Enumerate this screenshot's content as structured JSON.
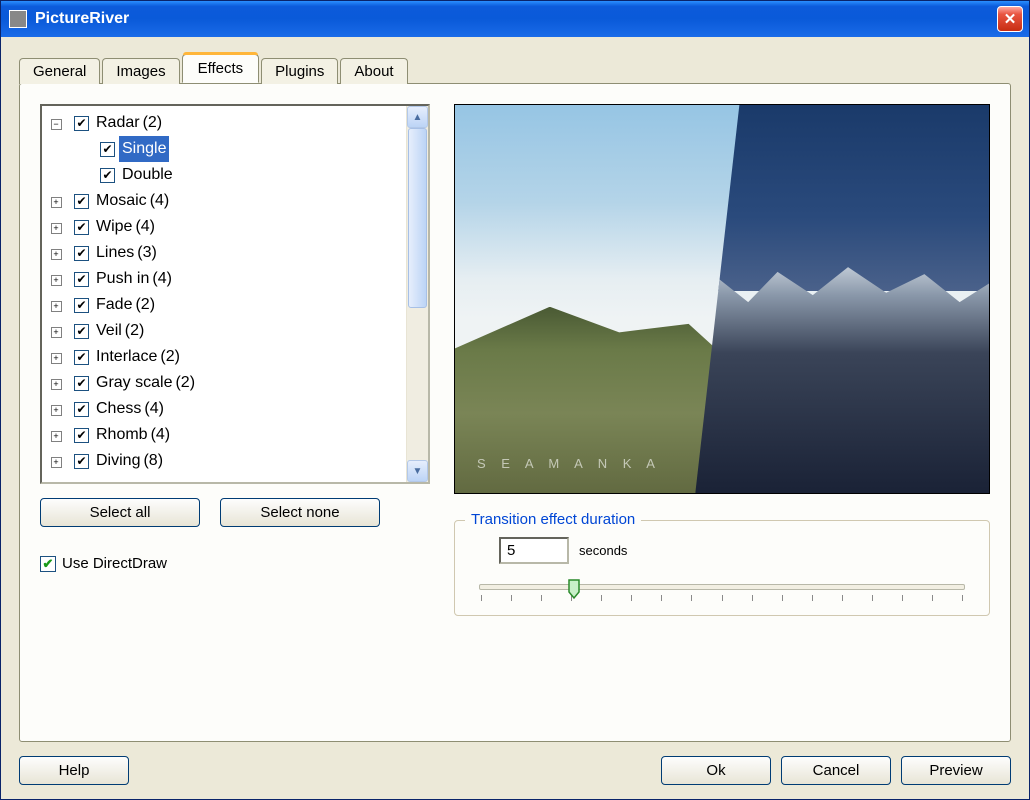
{
  "window": {
    "title": "PictureRiver"
  },
  "tabs": [
    "General",
    "Images",
    "Effects",
    "Plugins",
    "About"
  ],
  "active_tab": 2,
  "tree": [
    {
      "expanded": true,
      "checked": true,
      "label": "Radar",
      "count": 2
    },
    {
      "child": true,
      "checked": true,
      "label": "Single",
      "selected": true
    },
    {
      "child": true,
      "checked": true,
      "label": "Double"
    },
    {
      "expanded": false,
      "checked": true,
      "label": "Mosaic",
      "count": 4
    },
    {
      "expanded": false,
      "checked": true,
      "label": "Wipe",
      "count": 4
    },
    {
      "expanded": false,
      "checked": true,
      "label": "Lines",
      "count": 3
    },
    {
      "expanded": false,
      "checked": true,
      "label": "Push in",
      "count": 4
    },
    {
      "expanded": false,
      "checked": true,
      "label": "Fade",
      "count": 2
    },
    {
      "expanded": false,
      "checked": true,
      "label": "Veil",
      "count": 2
    },
    {
      "expanded": false,
      "checked": true,
      "label": "Interlace",
      "count": 2
    },
    {
      "expanded": false,
      "checked": true,
      "label": "Gray scale",
      "count": 2
    },
    {
      "expanded": false,
      "checked": true,
      "label": "Chess",
      "count": 4
    },
    {
      "expanded": false,
      "checked": true,
      "label": "Rhomb",
      "count": 4
    },
    {
      "expanded": false,
      "checked": true,
      "label": "Diving",
      "count": 8
    }
  ],
  "buttons": {
    "select_all": "Select all",
    "select_none": "Select none"
  },
  "directdraw": {
    "checked": true,
    "label": "Use DirectDraw"
  },
  "duration": {
    "legend": "Transition effect duration",
    "value": "5",
    "unit": "seconds",
    "slider_percent": 18
  },
  "preview_watermark": "S E A M A N K A",
  "footer": {
    "help": "Help",
    "ok": "Ok",
    "cancel": "Cancel",
    "preview": "Preview"
  }
}
